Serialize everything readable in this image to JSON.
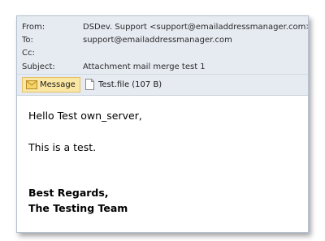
{
  "header": {
    "from_label": "From:",
    "from_value": "DSDev. Support <support@emailaddressmanager.com>",
    "to_label": "To:",
    "to_value": "support@emailaddressmanager.com",
    "cc_label": "Cc:",
    "cc_value": "",
    "subject_label": "Subject:",
    "subject_value": "Attachment mail merge test 1"
  },
  "tabs": {
    "message_label": "Message",
    "attachment_label": "Test.file (107 B)"
  },
  "body": {
    "greeting": "Hello Test own_server,",
    "text": "This is a test.",
    "closing1": "Best Regards,",
    "closing2": "The Testing Team"
  },
  "colors": {
    "header_bg": "#e6ebf2",
    "tab_active_bg": "#fbe7a4"
  },
  "icons": {
    "message_tab": "envelope-icon",
    "attachment": "file-icon"
  }
}
